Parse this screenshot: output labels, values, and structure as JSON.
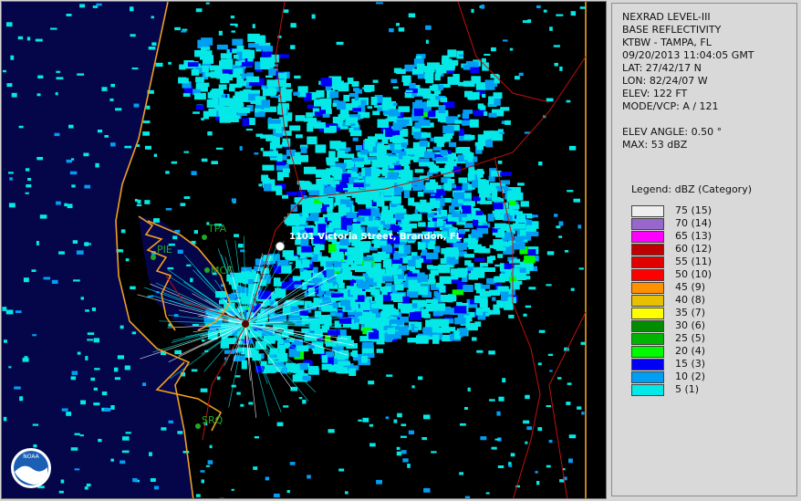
{
  "info": {
    "product": "NEXRAD LEVEL-III",
    "type": "BASE REFLECTIVITY",
    "station": "KTBW - TAMPA, FL",
    "datetime": "09/20/2013 11:04:05 GMT",
    "lat": "LAT: 27/42/17 N",
    "lon": "LON: 82/24/07 W",
    "elev": "ELEV: 122 FT",
    "mode": "MODE/VCP: A / 121",
    "elev_angle": "ELEV ANGLE: 0.50 °",
    "max": "MAX: 53 dBZ"
  },
  "legend": {
    "title": "Legend: dBZ (Category)",
    "items": [
      {
        "label": "75  (15)",
        "color": "#eeeeee"
      },
      {
        "label": "70  (14)",
        "color": "#9966cc"
      },
      {
        "label": "65  (13)",
        "color": "#ff00ff"
      },
      {
        "label": "60  (12)",
        "color": "#c00000"
      },
      {
        "label": "55  (11)",
        "color": "#e00000"
      },
      {
        "label": "50  (10)",
        "color": "#ff0000"
      },
      {
        "label": "45  (9)",
        "color": "#ff9000"
      },
      {
        "label": "40  (8)",
        "color": "#e7c000"
      },
      {
        "label": "35  (7)",
        "color": "#ffff00"
      },
      {
        "label": "30  (6)",
        "color": "#008e00"
      },
      {
        "label": "25  (5)",
        "color": "#00b400"
      },
      {
        "label": "20  (4)",
        "color": "#00fb00"
      },
      {
        "label": "15  (3)",
        "color": "#0000f6"
      },
      {
        "label": "10  (2)",
        "color": "#019ff4"
      },
      {
        "label": "5  (1)",
        "color": "#04e9e7"
      }
    ]
  },
  "map": {
    "places": [
      "TPA",
      "PIE",
      "MCF",
      "SRQ"
    ],
    "location": "1101 Victoria Street, Brandon, FL",
    "logo": "NOAA"
  }
}
